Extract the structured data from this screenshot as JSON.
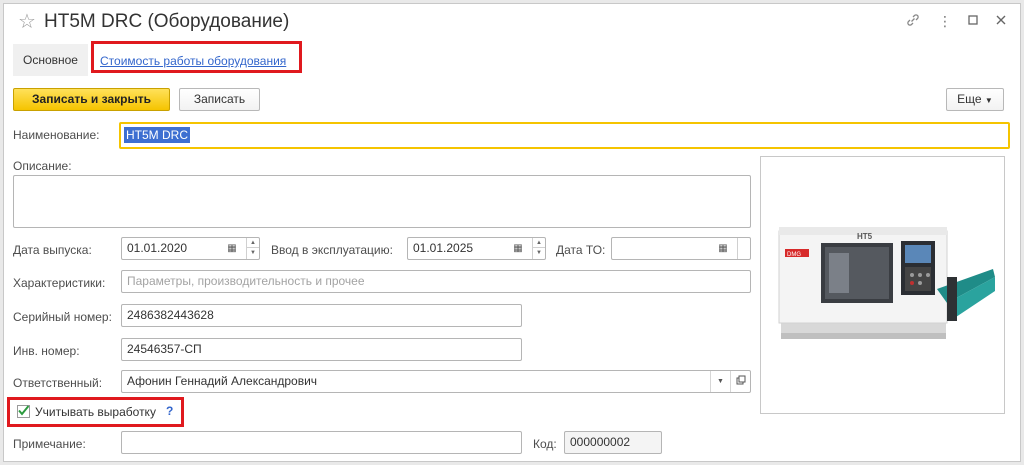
{
  "window": {
    "title": "HT5M DRC (Оборудование)"
  },
  "tabs": {
    "main_label": "Основное",
    "link_label": "Стоимость работы оборудования"
  },
  "toolbar": {
    "save_close_label": "Записать и закрыть",
    "save_label": "Записать",
    "more_label": "Еще"
  },
  "form": {
    "name_label": "Наименование:",
    "name_value": "HT5M DRC",
    "description_label": "Описание:",
    "description_value": "",
    "release_date_label": "Дата выпуска:",
    "release_date_value": "01.01.2020",
    "commissioning_label": "Ввод в эксплуатацию:",
    "commissioning_value": "01.01.2025",
    "maintenance_label": "Дата ТО:",
    "maintenance_value": "  .  .",
    "characteristics_label": "Характеристики:",
    "characteristics_placeholder": "Параметры, производительность и прочее",
    "serial_label": "Серийный номер:",
    "serial_value": "2486382443628",
    "inventory_label": "Инв. номер:",
    "inventory_value": "24546357-СП",
    "responsible_label": "Ответственный:",
    "responsible_value": "Афонин Геннадий Александрович",
    "track_output_label": "Учитывать выработку",
    "track_output_checked": true,
    "help_label": "?",
    "note_label": "Примечание:",
    "note_value": "",
    "code_label": "Код:",
    "code_value": "000000002"
  },
  "image": {
    "brand_text": "HT5",
    "badge_text": "DMG"
  },
  "colors": {
    "accent": "#f5c400",
    "link": "#3366cc",
    "highlight_box": "#e0191e",
    "selection": "#3d6fd1"
  }
}
